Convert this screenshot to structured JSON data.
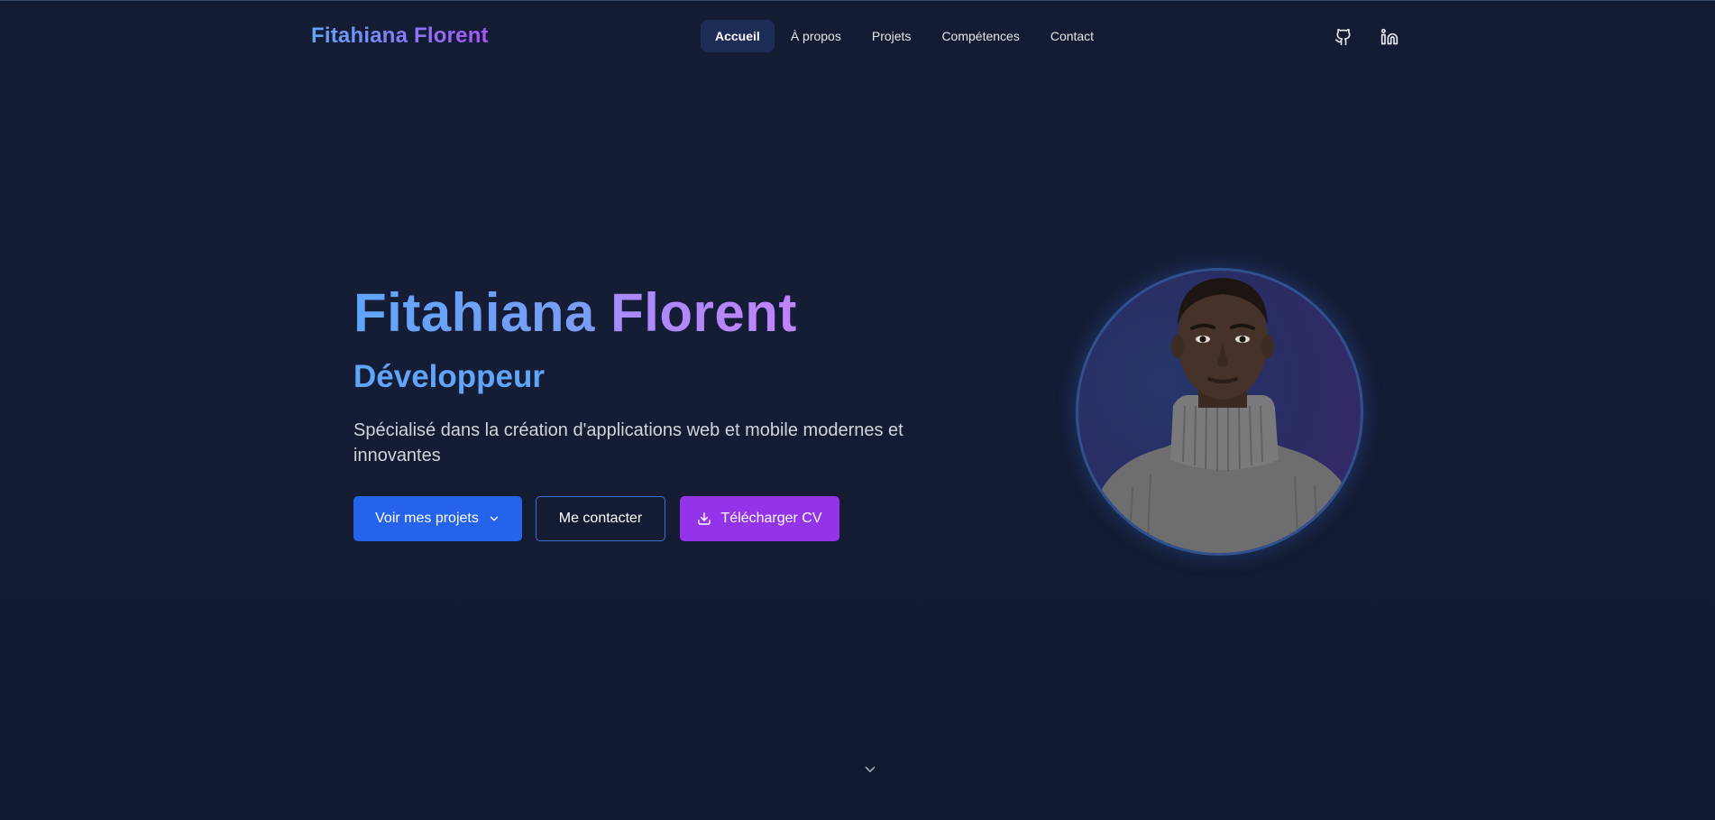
{
  "brand": {
    "name": "Fitahiana Florent"
  },
  "nav": {
    "items": [
      {
        "label": "Accueil",
        "active": true
      },
      {
        "label": "À propos",
        "active": false
      },
      {
        "label": "Projets",
        "active": false
      },
      {
        "label": "Compétences",
        "active": false
      },
      {
        "label": "Contact",
        "active": false
      }
    ],
    "social": [
      {
        "icon": "github-icon"
      },
      {
        "icon": "linkedin-icon"
      }
    ]
  },
  "hero": {
    "first_name": "Fitahiana",
    "last_name": "Florent",
    "role": "Développeur",
    "description": "Spécialisé dans la création d'applications web et mobile modernes et innovantes",
    "buttons": {
      "projects": "Voir mes projets",
      "contact": "Me contacter",
      "cv": "Télécharger CV"
    }
  },
  "colors": {
    "background": "#131c33",
    "accent_blue": "#2563eb",
    "accent_purple": "#9333ea",
    "role_text": "#60a5fa"
  }
}
